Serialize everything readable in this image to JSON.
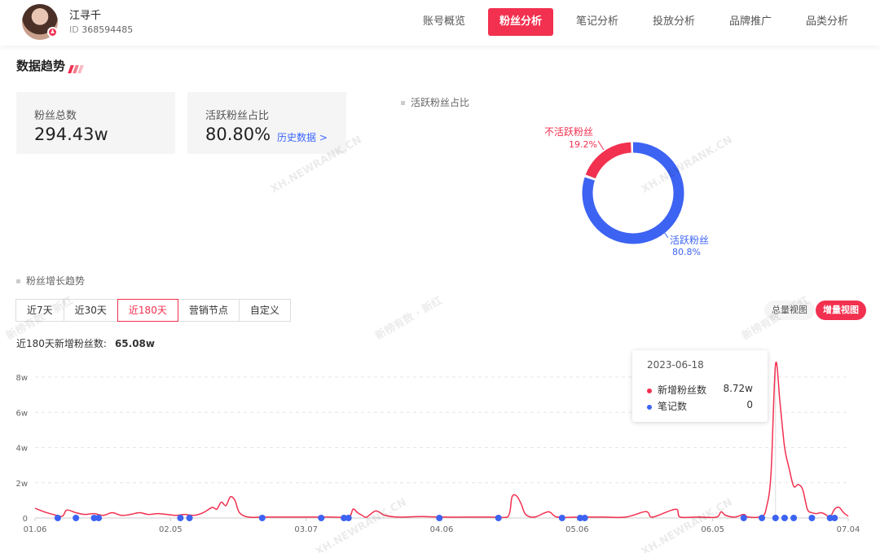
{
  "header": {
    "user_name": "江寻千",
    "user_id_label": "ID",
    "user_id": "368594485",
    "nav": [
      "账号概览",
      "粉丝分析",
      "笔记分析",
      "投放分析",
      "品牌推广",
      "品类分析"
    ],
    "active_nav": "粉丝分析"
  },
  "section": {
    "title": "数据趋势"
  },
  "stats": {
    "total_fans_label": "粉丝总数",
    "total_fans_value": "294.43w",
    "active_ratio_label": "活跃粉丝占比",
    "active_ratio_value": "80.80%",
    "history_link": "历史数据 >"
  },
  "donut": {
    "title": "活跃粉丝占比",
    "chart_data": {
      "type": "pie",
      "slices": [
        {
          "name": "活跃粉丝",
          "value": 80.8,
          "label": "80.8%",
          "color": "#3d63f2"
        },
        {
          "name": "不活跃粉丝",
          "value": 19.2,
          "label": "19.2%",
          "color": "#f2304f"
        }
      ]
    }
  },
  "growth": {
    "title": "粉丝增长趋势",
    "tabs": [
      "近7天",
      "近30天",
      "近180天",
      "营销节点",
      "自定义"
    ],
    "active_tab": "近180天",
    "view_total": "总量视图",
    "view_increment": "增量视图",
    "summary_label": "近180天新增粉丝数:",
    "summary_value": "65.08w",
    "tooltip": {
      "date": "2023-06-18",
      "rows": [
        {
          "name": "新增粉丝数",
          "value": "8.72w",
          "color": "#f2304f"
        },
        {
          "name": "笔记数",
          "value": "0",
          "color": "#3d63f2"
        }
      ]
    }
  },
  "chart_data": {
    "type": "line",
    "x_ticks": [
      "01.06",
      "02.05",
      "03.07",
      "04.06",
      "05.06",
      "06.05",
      "07.04"
    ],
    "y_ticks": [
      "0",
      "2w",
      "4w",
      "6w",
      "8w"
    ],
    "ylim": [
      0,
      8
    ],
    "x_range": [
      0,
      179
    ],
    "grid": true,
    "series": [
      {
        "name": "新增粉丝数",
        "color": "#f2304f",
        "points": [
          [
            0,
            0.55
          ],
          [
            2,
            0.35
          ],
          [
            4,
            0.2
          ],
          [
            6,
            0.1
          ],
          [
            7,
            0.45
          ],
          [
            9,
            0.3
          ],
          [
            11,
            0.2
          ],
          [
            13,
            0.25
          ],
          [
            15,
            0.15
          ],
          [
            17,
            0.3
          ],
          [
            19,
            0.15
          ],
          [
            21,
            0.2
          ],
          [
            23,
            0.3
          ],
          [
            25,
            0.2
          ],
          [
            27,
            0.25
          ],
          [
            29,
            0.2
          ],
          [
            31,
            0.15
          ],
          [
            33,
            0.2
          ],
          [
            35,
            0.15
          ],
          [
            37,
            0.3
          ],
          [
            39,
            0.6
          ],
          [
            40,
            0.5
          ],
          [
            41,
            0.9
          ],
          [
            42,
            0.7
          ],
          [
            43,
            1.2
          ],
          [
            44,
            1.0
          ],
          [
            45,
            0.3
          ],
          [
            47,
            0.05
          ],
          [
            50,
            0.05
          ],
          [
            55,
            0.05
          ],
          [
            60,
            0.05
          ],
          [
            65,
            0.05
          ],
          [
            69,
            0.05
          ],
          [
            70,
            0.5
          ],
          [
            71,
            0.3
          ],
          [
            72,
            0.15
          ],
          [
            73,
            0.05
          ],
          [
            75,
            0.4
          ],
          [
            77,
            0.15
          ],
          [
            80,
            0.05
          ],
          [
            85,
            0.08
          ],
          [
            90,
            0.05
          ],
          [
            95,
            0.05
          ],
          [
            100,
            0.05
          ],
          [
            104,
            0.05
          ],
          [
            105,
            1.2
          ],
          [
            106,
            1.25
          ],
          [
            107,
            0.8
          ],
          [
            108,
            0.2
          ],
          [
            110,
            0.05
          ],
          [
            113,
            0.35
          ],
          [
            115,
            0.05
          ],
          [
            120,
            0.05
          ],
          [
            125,
            0.05
          ],
          [
            130,
            0.05
          ],
          [
            134,
            0.35
          ],
          [
            135,
            0.3
          ],
          [
            136,
            0.05
          ],
          [
            141,
            0.5
          ],
          [
            142,
            0.05
          ],
          [
            146,
            0.05
          ],
          [
            150,
            0.05
          ],
          [
            151,
            0.35
          ],
          [
            152,
            0.15
          ],
          [
            154,
            0.05
          ],
          [
            156,
            0.2
          ],
          [
            157,
            0.05
          ],
          [
            160,
            0.1
          ],
          [
            161,
            0.6
          ],
          [
            162,
            2.5
          ],
          [
            163,
            8.72
          ],
          [
            164,
            6.5
          ],
          [
            165,
            4.0
          ],
          [
            166,
            2.8
          ],
          [
            167,
            1.8
          ],
          [
            168,
            1.9
          ],
          [
            169,
            1.6
          ],
          [
            170,
            0.5
          ],
          [
            171,
            0.3
          ],
          [
            172,
            0.25
          ],
          [
            173,
            0.3
          ],
          [
            174,
            0.2
          ],
          [
            175,
            0.05
          ],
          [
            176,
            0.5
          ],
          [
            177,
            0.6
          ],
          [
            178,
            0.3
          ],
          [
            179,
            0.1
          ]
        ]
      },
      {
        "name": "笔记数",
        "color": "#3d63f2",
        "x": [
          5,
          9,
          13,
          14,
          32,
          34,
          50,
          63,
          68,
          69,
          89,
          102,
          116,
          120,
          121,
          156,
          160,
          163,
          165,
          167,
          171,
          175,
          176
        ]
      }
    ]
  },
  "watermarks": [
    "XH.NEWRANK.CN",
    "新榜有数 · 新红"
  ]
}
